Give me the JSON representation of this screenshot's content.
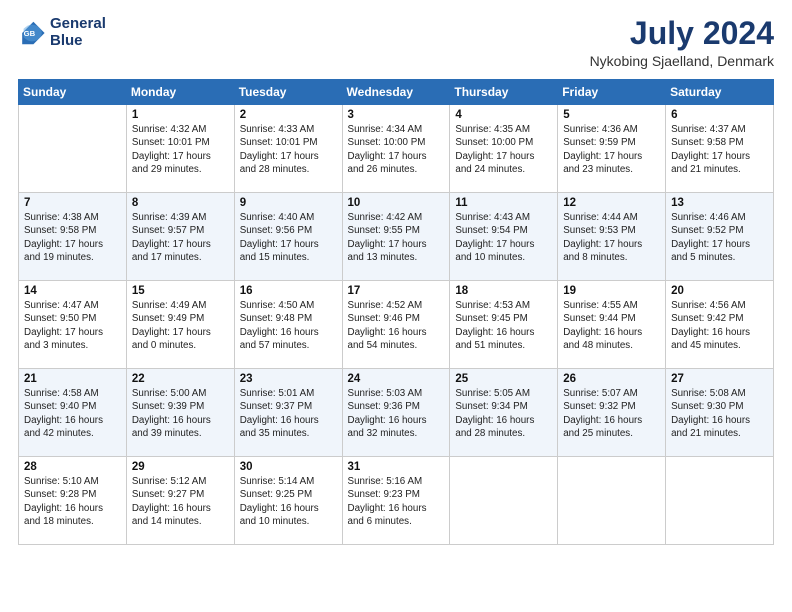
{
  "header": {
    "logo_line1": "General",
    "logo_line2": "Blue",
    "month_title": "July 2024",
    "location": "Nykobing Sjaelland, Denmark"
  },
  "days_of_week": [
    "Sunday",
    "Monday",
    "Tuesday",
    "Wednesday",
    "Thursday",
    "Friday",
    "Saturday"
  ],
  "weeks": [
    [
      {
        "day": "",
        "info": ""
      },
      {
        "day": "1",
        "info": "Sunrise: 4:32 AM\nSunset: 10:01 PM\nDaylight: 17 hours\nand 29 minutes."
      },
      {
        "day": "2",
        "info": "Sunrise: 4:33 AM\nSunset: 10:01 PM\nDaylight: 17 hours\nand 28 minutes."
      },
      {
        "day": "3",
        "info": "Sunrise: 4:34 AM\nSunset: 10:00 PM\nDaylight: 17 hours\nand 26 minutes."
      },
      {
        "day": "4",
        "info": "Sunrise: 4:35 AM\nSunset: 10:00 PM\nDaylight: 17 hours\nand 24 minutes."
      },
      {
        "day": "5",
        "info": "Sunrise: 4:36 AM\nSunset: 9:59 PM\nDaylight: 17 hours\nand 23 minutes."
      },
      {
        "day": "6",
        "info": "Sunrise: 4:37 AM\nSunset: 9:58 PM\nDaylight: 17 hours\nand 21 minutes."
      }
    ],
    [
      {
        "day": "7",
        "info": "Sunrise: 4:38 AM\nSunset: 9:58 PM\nDaylight: 17 hours\nand 19 minutes."
      },
      {
        "day": "8",
        "info": "Sunrise: 4:39 AM\nSunset: 9:57 PM\nDaylight: 17 hours\nand 17 minutes."
      },
      {
        "day": "9",
        "info": "Sunrise: 4:40 AM\nSunset: 9:56 PM\nDaylight: 17 hours\nand 15 minutes."
      },
      {
        "day": "10",
        "info": "Sunrise: 4:42 AM\nSunset: 9:55 PM\nDaylight: 17 hours\nand 13 minutes."
      },
      {
        "day": "11",
        "info": "Sunrise: 4:43 AM\nSunset: 9:54 PM\nDaylight: 17 hours\nand 10 minutes."
      },
      {
        "day": "12",
        "info": "Sunrise: 4:44 AM\nSunset: 9:53 PM\nDaylight: 17 hours\nand 8 minutes."
      },
      {
        "day": "13",
        "info": "Sunrise: 4:46 AM\nSunset: 9:52 PM\nDaylight: 17 hours\nand 5 minutes."
      }
    ],
    [
      {
        "day": "14",
        "info": "Sunrise: 4:47 AM\nSunset: 9:50 PM\nDaylight: 17 hours\nand 3 minutes."
      },
      {
        "day": "15",
        "info": "Sunrise: 4:49 AM\nSunset: 9:49 PM\nDaylight: 17 hours\nand 0 minutes."
      },
      {
        "day": "16",
        "info": "Sunrise: 4:50 AM\nSunset: 9:48 PM\nDaylight: 16 hours\nand 57 minutes."
      },
      {
        "day": "17",
        "info": "Sunrise: 4:52 AM\nSunset: 9:46 PM\nDaylight: 16 hours\nand 54 minutes."
      },
      {
        "day": "18",
        "info": "Sunrise: 4:53 AM\nSunset: 9:45 PM\nDaylight: 16 hours\nand 51 minutes."
      },
      {
        "day": "19",
        "info": "Sunrise: 4:55 AM\nSunset: 9:44 PM\nDaylight: 16 hours\nand 48 minutes."
      },
      {
        "day": "20",
        "info": "Sunrise: 4:56 AM\nSunset: 9:42 PM\nDaylight: 16 hours\nand 45 minutes."
      }
    ],
    [
      {
        "day": "21",
        "info": "Sunrise: 4:58 AM\nSunset: 9:40 PM\nDaylight: 16 hours\nand 42 minutes."
      },
      {
        "day": "22",
        "info": "Sunrise: 5:00 AM\nSunset: 9:39 PM\nDaylight: 16 hours\nand 39 minutes."
      },
      {
        "day": "23",
        "info": "Sunrise: 5:01 AM\nSunset: 9:37 PM\nDaylight: 16 hours\nand 35 minutes."
      },
      {
        "day": "24",
        "info": "Sunrise: 5:03 AM\nSunset: 9:36 PM\nDaylight: 16 hours\nand 32 minutes."
      },
      {
        "day": "25",
        "info": "Sunrise: 5:05 AM\nSunset: 9:34 PM\nDaylight: 16 hours\nand 28 minutes."
      },
      {
        "day": "26",
        "info": "Sunrise: 5:07 AM\nSunset: 9:32 PM\nDaylight: 16 hours\nand 25 minutes."
      },
      {
        "day": "27",
        "info": "Sunrise: 5:08 AM\nSunset: 9:30 PM\nDaylight: 16 hours\nand 21 minutes."
      }
    ],
    [
      {
        "day": "28",
        "info": "Sunrise: 5:10 AM\nSunset: 9:28 PM\nDaylight: 16 hours\nand 18 minutes."
      },
      {
        "day": "29",
        "info": "Sunrise: 5:12 AM\nSunset: 9:27 PM\nDaylight: 16 hours\nand 14 minutes."
      },
      {
        "day": "30",
        "info": "Sunrise: 5:14 AM\nSunset: 9:25 PM\nDaylight: 16 hours\nand 10 minutes."
      },
      {
        "day": "31",
        "info": "Sunrise: 5:16 AM\nSunset: 9:23 PM\nDaylight: 16 hours\nand 6 minutes."
      },
      {
        "day": "",
        "info": ""
      },
      {
        "day": "",
        "info": ""
      },
      {
        "day": "",
        "info": ""
      }
    ]
  ]
}
